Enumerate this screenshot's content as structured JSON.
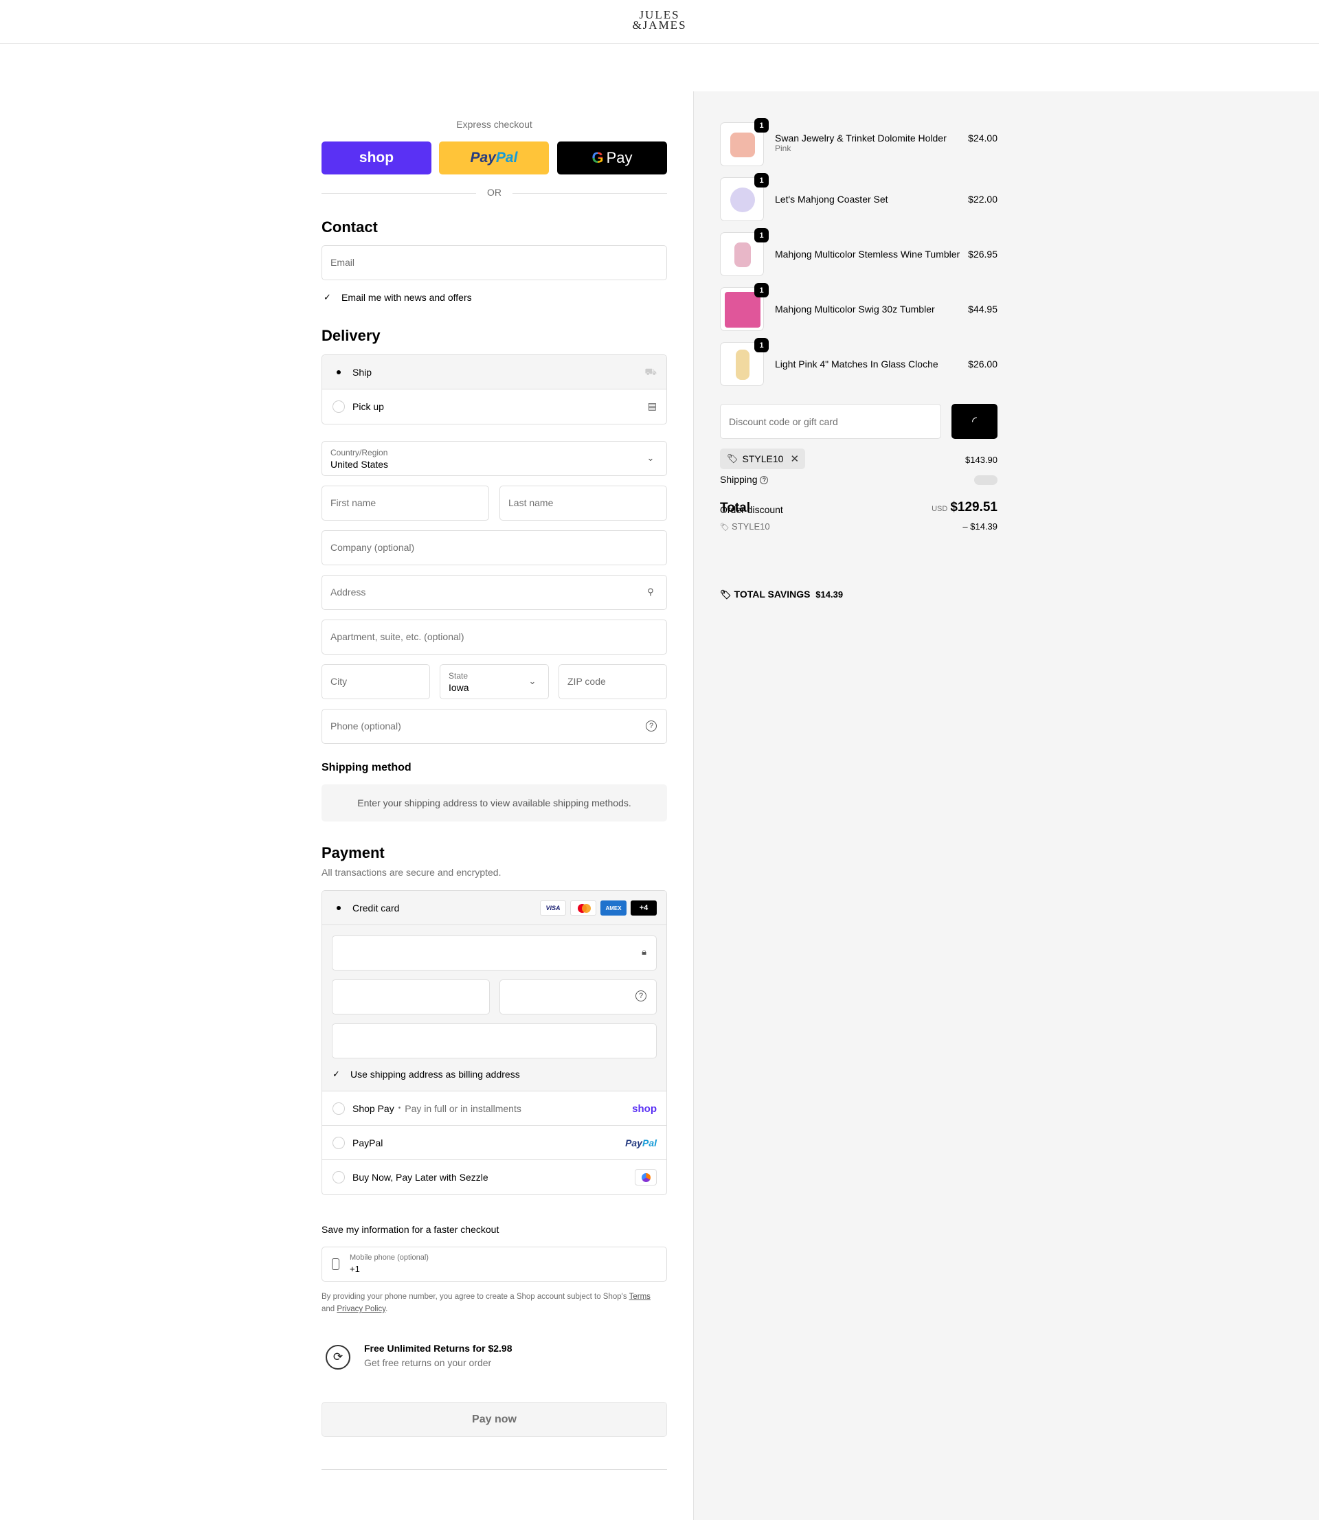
{
  "header": {
    "logo_line1": "JULES",
    "logo_line2": "&JAMES"
  },
  "express": {
    "title": "Express checkout",
    "shop_label": "shop",
    "paypal_a": "Pay",
    "paypal_b": "Pal",
    "gpay_g": "G",
    "gpay_label": "Pay",
    "or": "OR"
  },
  "contact": {
    "heading": "Contact",
    "email_placeholder": "Email",
    "newsletter_label": "Email me with news and offers",
    "newsletter_checked": true
  },
  "delivery": {
    "heading": "Delivery",
    "options": [
      {
        "label": "Ship",
        "selected": true
      },
      {
        "label": "Pick up",
        "selected": false
      }
    ],
    "country_label": "Country/Region",
    "country_value": "United States",
    "first_name": "First name",
    "last_name": "Last name",
    "company": "Company (optional)",
    "address": "Address",
    "apartment": "Apartment, suite, etc. (optional)",
    "city": "City",
    "state_label": "State",
    "state_value": "Iowa",
    "zip": "ZIP code",
    "phone": "Phone (optional)"
  },
  "shipping_method": {
    "heading": "Shipping method",
    "notice": "Enter your shipping address to view available shipping methods."
  },
  "payment": {
    "heading": "Payment",
    "subtitle": "All transactions are secure and encrypted.",
    "credit_card_label": "Credit card",
    "card_brands": [
      "VISA",
      "",
      "AMEX",
      "+4"
    ],
    "billing_same_label": "Use shipping address as billing address",
    "shoppay_label": "Shop Pay",
    "shoppay_sub": "Pay in full or in installments",
    "shoppay_brand": "shop",
    "paypal_label": "PayPal",
    "paypal_brand_a": "Pay",
    "paypal_brand_b": "Pal",
    "sezzle_label": "Buy Now, Pay Later with Sezzle"
  },
  "save_info": {
    "heading": "Save my information for a faster checkout",
    "mobile_label": "Mobile phone (optional)",
    "mobile_value": "+1",
    "legal_text": "By providing your phone number, you agree to create a Shop account subject to Shop's ",
    "legal_terms": "Terms",
    "legal_and": "and ",
    "legal_privacy": "Privacy Policy",
    "legal_end": "."
  },
  "returns": {
    "title": "Free Unlimited Returns for $2.98",
    "subtitle": "Get free returns on your order"
  },
  "pay_now": "Pay now",
  "summary": {
    "items": [
      {
        "name": "Swan Jewelry & Trinket Dolomite Holder",
        "variant": "Pink",
        "price": "$24.00",
        "qty": "1",
        "color": "#f2b8a8"
      },
      {
        "name": "Let's Mahjong Coaster Set",
        "variant": "",
        "price": "$22.00",
        "qty": "1",
        "color": "#d9d3f2"
      },
      {
        "name": "Mahjong Multicolor Stemless Wine Tumbler",
        "variant": "",
        "price": "$26.95",
        "qty": "1",
        "color": "#e8b7c8"
      },
      {
        "name": "Mahjong Multicolor Swig 30z Tumbler",
        "variant": "",
        "price": "$44.95",
        "qty": "1",
        "color": "#e0569a"
      },
      {
        "name": "Light Pink 4\" Matches In Glass Cloche",
        "variant": "",
        "price": "$26.00",
        "qty": "1",
        "color": "#f1d9a0"
      }
    ],
    "discount_placeholder": "Discount code or gift card",
    "code_chip": "STYLE10",
    "subtotal_value": "$143.90",
    "shipping_label": "Shipping",
    "order_discount_label": "Order discount",
    "total_label": "Total",
    "currency": "USD",
    "total_value": "$129.51",
    "discount_code": "STYLE10",
    "discount_value": "– $14.39",
    "savings_label": "TOTAL SAVINGS",
    "savings_value": "$14.39"
  }
}
